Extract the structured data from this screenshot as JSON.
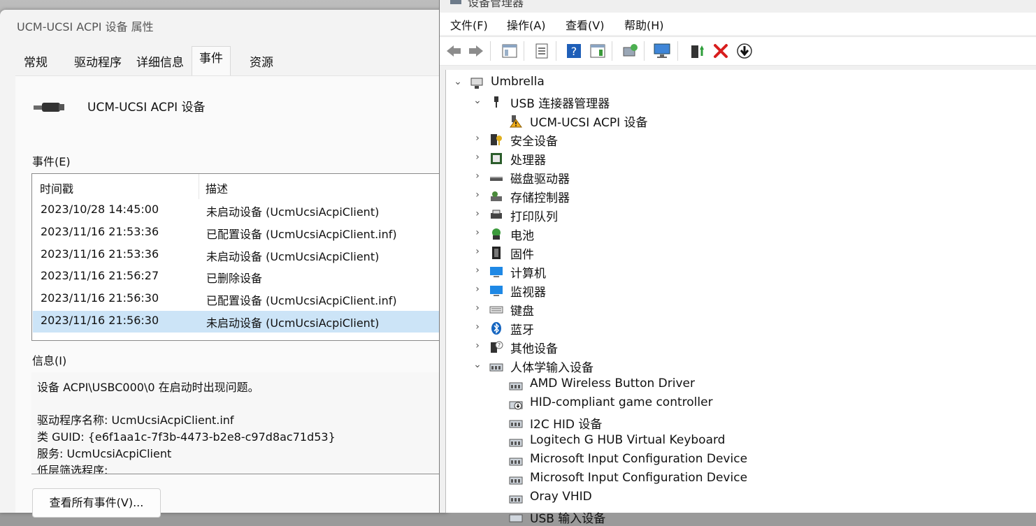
{
  "props": {
    "title": "UCM-UCSI ACPI 设备 属性",
    "tabs": [
      "常规",
      "驱动程序",
      "详细信息",
      "事件",
      "资源"
    ],
    "device_name": "UCM-UCSI ACPI 设备",
    "events_label": "事件(E)",
    "columns": [
      "时间戳",
      "描述"
    ],
    "events": [
      {
        "time": "2023/10/28 14:45:00",
        "desc": "未启动设备 (UcmUcsiAcpiClient)"
      },
      {
        "time": "2023/11/16 21:53:36",
        "desc": "已配置设备 (UcmUcsiAcpiClient.inf)"
      },
      {
        "time": "2023/11/16 21:53:36",
        "desc": "未启动设备 (UcmUcsiAcpiClient)"
      },
      {
        "time": "2023/11/16 21:56:27",
        "desc": "已删除设备"
      },
      {
        "time": "2023/11/16 21:56:30",
        "desc": "已配置设备 (UcmUcsiAcpiClient.inf)"
      },
      {
        "time": "2023/11/16 21:56:30",
        "desc": "未启动设备 (UcmUcsiAcpiClient)"
      }
    ],
    "info_label": "信息(I)",
    "info_lines": [
      "设备 ACPI\\USBC000\\0 在启动时出现问题。",
      "",
      "驱动程序名称: UcmUcsiAcpiClient.inf",
      "类 GUID: {e6f1aa1c-7f3b-4473-b2e8-c97d8ac71d53}",
      "服务: UcmUcsiAcpiClient",
      "低层筛选程序:"
    ],
    "view_all_button": "查看所有事件(V)..."
  },
  "devmgr": {
    "title": "设备管理器",
    "menu": [
      "文件(F)",
      "操作(A)",
      "查看(V)",
      "帮助(H)"
    ],
    "tree": [
      {
        "label": "Umbrella",
        "icon": "computer-icon",
        "chevron": "⌄"
      },
      {
        "label": "USB 连接器管理器",
        "icon": "usb-icon",
        "chevron": "⌄"
      },
      {
        "label": "UCM-UCSI ACPI 设备",
        "icon": "warning-device-icon",
        "chevron": ""
      },
      {
        "label": "安全设备",
        "icon": "security-device-icon",
        "chevron": "›"
      },
      {
        "label": "处理器",
        "icon": "processor-icon",
        "chevron": "›"
      },
      {
        "label": "磁盘驱动器",
        "icon": "disk-drive-icon",
        "chevron": "›"
      },
      {
        "label": "存储控制器",
        "icon": "storage-controller-icon",
        "chevron": "›"
      },
      {
        "label": "打印队列",
        "icon": "printer-icon",
        "chevron": "›"
      },
      {
        "label": "电池",
        "icon": "battery-icon",
        "chevron": "›"
      },
      {
        "label": "固件",
        "icon": "firmware-icon",
        "chevron": "›"
      },
      {
        "label": "计算机",
        "icon": "computer-monitor-icon",
        "chevron": "›"
      },
      {
        "label": "监视器",
        "icon": "monitor-icon",
        "chevron": "›"
      },
      {
        "label": "键盘",
        "icon": "keyboard-icon",
        "chevron": "›"
      },
      {
        "label": "蓝牙",
        "icon": "bluetooth-icon",
        "chevron": "›"
      },
      {
        "label": "其他设备",
        "icon": "other-device-icon",
        "chevron": "›"
      },
      {
        "label": "人体学输入设备",
        "icon": "hid-icon",
        "chevron": "⌄"
      },
      {
        "label": "AMD Wireless Button Driver",
        "icon": "hid-icon",
        "chevron": ""
      },
      {
        "label": "HID-compliant game controller",
        "icon": "hid-download-icon",
        "chevron": ""
      },
      {
        "label": "I2C HID 设备",
        "icon": "hid-icon",
        "chevron": ""
      },
      {
        "label": "Logitech G HUB Virtual Keyboard",
        "icon": "hid-icon",
        "chevron": ""
      },
      {
        "label": "Microsoft Input Configuration Device",
        "icon": "hid-icon",
        "chevron": ""
      },
      {
        "label": "Microsoft Input Configuration Device",
        "icon": "hid-icon",
        "chevron": ""
      },
      {
        "label": "Oray VHID",
        "icon": "hid-icon",
        "chevron": ""
      },
      {
        "label": "USB 输入设备",
        "icon": "hid-icon",
        "chevron": ""
      }
    ]
  }
}
